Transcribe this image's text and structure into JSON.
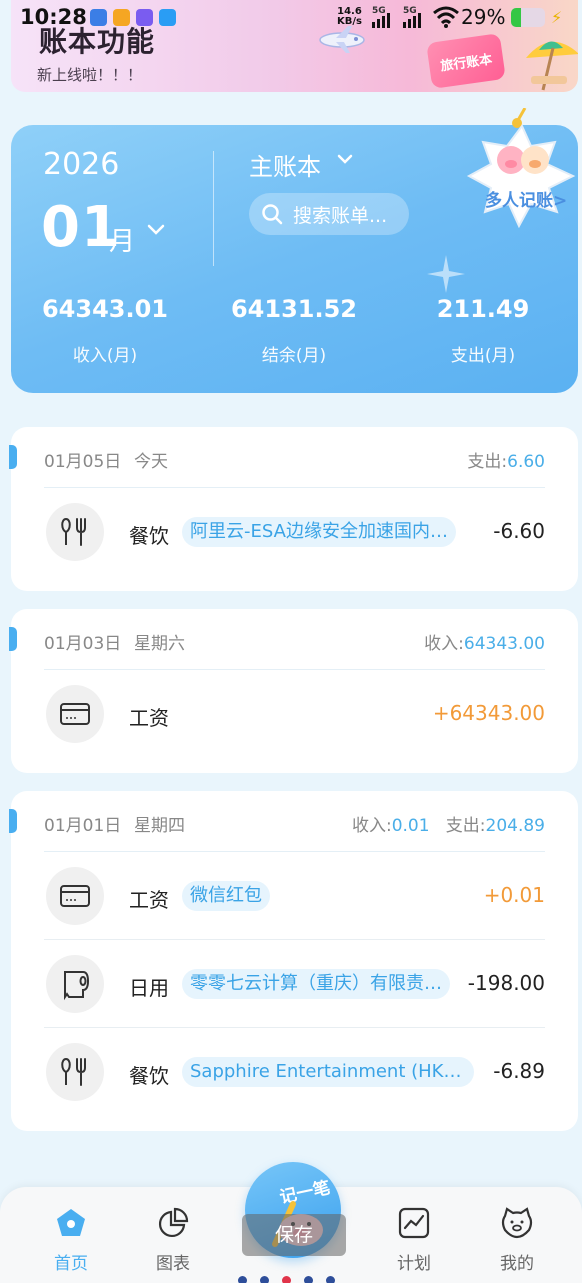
{
  "status_bar": {
    "time": "10:28",
    "network_speed": "14.6",
    "network_unit": "KB/s",
    "sim1": "5G",
    "sim2": "5G",
    "battery_percent": "29%",
    "battery_level": 0.29
  },
  "banner": {
    "headline": "账本功能",
    "subtitle": "新上线啦！！！",
    "tag": "旅行账本"
  },
  "summary": {
    "year": "2026",
    "month": "01",
    "month_unit": "月",
    "book_name": "主账本",
    "search_placeholder": "搜索账单...",
    "income_value": "64343.01",
    "income_label": "收入(月)",
    "balance_value": "64131.52",
    "balance_label": "结余(月)",
    "expense_value": "211.49",
    "expense_label": "支出(月)",
    "multi_user_label": "多人记账>"
  },
  "days": [
    {
      "date": "01月05日",
      "weekday": "今天",
      "totals": [
        {
          "label": "支出:",
          "value": "6.60"
        }
      ],
      "entries": [
        {
          "category": "餐饮",
          "icon": "utensils-icon",
          "memo": "阿里云-ESA边缘安全加速国内…",
          "amount": "-6.60",
          "type": "expense"
        }
      ]
    },
    {
      "date": "01月03日",
      "weekday": "星期六",
      "totals": [
        {
          "label": "收入:",
          "value": "64343.00"
        }
      ],
      "entries": [
        {
          "category": "工资",
          "icon": "card-icon",
          "memo": "",
          "amount": "+64343.00",
          "type": "income"
        }
      ]
    },
    {
      "date": "01月01日",
      "weekday": "星期四",
      "totals": [
        {
          "label": "收入:",
          "value": "0.01"
        },
        {
          "label": "支出:",
          "value": "204.89"
        }
      ],
      "entries": [
        {
          "category": "工资",
          "icon": "card-icon",
          "memo": "微信红包",
          "amount": "+0.01",
          "type": "income"
        },
        {
          "category": "日用",
          "icon": "tissue-roll-icon",
          "memo": "零零七云计算（重庆）有限责…",
          "amount": "-198.00",
          "type": "expense"
        },
        {
          "category": "餐饮",
          "icon": "utensils-icon",
          "memo": "Sapphire Entertainment (HK) …",
          "amount": "-6.89",
          "type": "expense"
        }
      ]
    }
  ],
  "fab": {
    "label": "记一笔",
    "tooltip": "保存"
  },
  "nav": [
    {
      "label": "首页",
      "icon": "home-icon",
      "active": true
    },
    {
      "label": "图表",
      "icon": "pie-chart-icon",
      "active": false
    },
    {
      "label": "计划",
      "icon": "trend-chart-icon",
      "active": false
    },
    {
      "label": "我的",
      "icon": "pig-face-icon",
      "active": false
    }
  ],
  "colors": {
    "accent": "#49aef0",
    "income": "#f29a38",
    "card_gradient": "#6ebcf4"
  }
}
